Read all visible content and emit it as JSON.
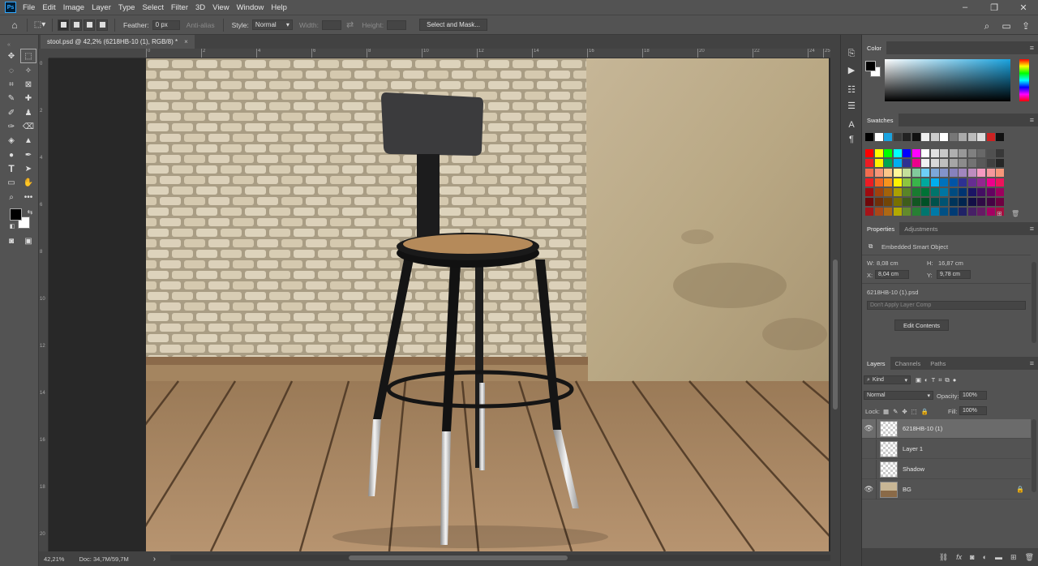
{
  "menu": [
    "File",
    "Edit",
    "Image",
    "Layer",
    "Type",
    "Select",
    "Filter",
    "3D",
    "View",
    "Window",
    "Help"
  ],
  "options": {
    "feather_label": "Feather:",
    "feather_value": "0 px",
    "antialias_label": "Anti-alias",
    "style_label": "Style:",
    "style_value": "Normal",
    "width_label": "Width:",
    "height_label": "Height:",
    "select_mask_label": "Select and Mask..."
  },
  "document": {
    "tab_title": "stool.psd @ 42,2% (6218HB-10 (1), RGB/8) *",
    "tab_close": "×"
  },
  "status": {
    "zoom": "42,21%",
    "doc": "Doc: 34,7M/59,7M",
    "arrow": "›"
  },
  "ruler_h": [
    "0",
    "2",
    "4",
    "6",
    "8",
    "10",
    "12",
    "14",
    "16",
    "18",
    "20",
    "22",
    "24",
    "25"
  ],
  "ruler_v": [
    "0",
    "2",
    "4",
    "6",
    "8",
    "10",
    "12",
    "14",
    "16",
    "18",
    "20"
  ],
  "color_panel": {
    "tab": "Color",
    "fg": "#000000",
    "bg": "#ffffff",
    "hue": "#1aa3df"
  },
  "swatches_panel": {
    "tab": "Swatches",
    "recent": [
      "#000000",
      "#ffffff",
      "#1aa3df",
      "#3a3a3a",
      "#222222",
      "#111111",
      "#eeeeee",
      "#cccccc",
      "#ffffff",
      "#777777",
      "#aaaaaa",
      "#bbbbbb",
      "#dddddd",
      "#cc2222",
      "#111111"
    ],
    "grid": [
      [
        "#ff0000",
        "#ffff00",
        "#00ff00",
        "#00ffff",
        "#0000ff",
        "#ff00ff",
        "#ffffff",
        "#e0e0e0",
        "#c8c8c8",
        "#b0b0b0",
        "#989898",
        "#808080",
        "#686868",
        "#505050",
        "#383838"
      ],
      [
        "#ed1c24",
        "#fff200",
        "#00a651",
        "#00aeef",
        "#2e3192",
        "#ec008c",
        "#f2f2f2",
        "#d9d9d9",
        "#bfbfbf",
        "#a6a6a6",
        "#8c8c8c",
        "#737373",
        "#595959",
        "#404040",
        "#262626"
      ],
      [
        "#f26c4f",
        "#f69679",
        "#fdc689",
        "#fff799",
        "#c4df9b",
        "#82ca9c",
        "#6dcff6",
        "#7da7d9",
        "#8393ca",
        "#8781bd",
        "#a186be",
        "#bd8cbf",
        "#f49ac1",
        "#f5989d",
        "#f7977a"
      ],
      [
        "#ed1c24",
        "#f26522",
        "#f7941d",
        "#fff200",
        "#8dc63f",
        "#39b54a",
        "#00a99d",
        "#00aeef",
        "#0072bc",
        "#0054a6",
        "#2e3192",
        "#662d91",
        "#92278f",
        "#ec008c",
        "#ed145b"
      ],
      [
        "#9e0b0f",
        "#a0410d",
        "#a36209",
        "#aba000",
        "#598527",
        "#197b30",
        "#007236",
        "#00746b",
        "#0076a3",
        "#004b80",
        "#003471",
        "#1b1464",
        "#440e62",
        "#630460",
        "#9e005d"
      ]
    ]
  },
  "properties_panel": {
    "tabs": [
      "Properties",
      "Adjustments"
    ],
    "type": "Embedded Smart Object",
    "w_label": "W:",
    "w_value": "8,08 cm",
    "h_label": "H:",
    "h_value": "16,87 cm",
    "x_label": "X:",
    "x_value": "8,04 cm",
    "y_label": "Y:",
    "y_value": "9,78 cm",
    "file": "6218HB-10 (1).psd",
    "layer_comp": "Don't Apply Layer Comp",
    "edit_contents": "Edit Contents"
  },
  "layers_panel": {
    "tabs": [
      "Layers",
      "Channels",
      "Paths"
    ],
    "kind": "Kind",
    "blend": "Normal",
    "opacity_label": "Opacity:",
    "opacity_value": "100%",
    "lock_label": "Lock:",
    "fill_label": "Fill:",
    "fill_value": "100%",
    "layers": [
      {
        "name": "6218HB-10 (1)",
        "visible": true,
        "selected": true
      },
      {
        "name": "Layer 1",
        "visible": false,
        "selected": false
      },
      {
        "name": "Shadow",
        "visible": false,
        "selected": false
      },
      {
        "name": "BG",
        "visible": true,
        "selected": false,
        "locked": true
      }
    ],
    "footer_icons": [
      "link-icon",
      "fx-icon",
      "mask-icon",
      "adjustment-icon",
      "folder-icon",
      "new-layer-icon",
      "trash-icon"
    ]
  }
}
